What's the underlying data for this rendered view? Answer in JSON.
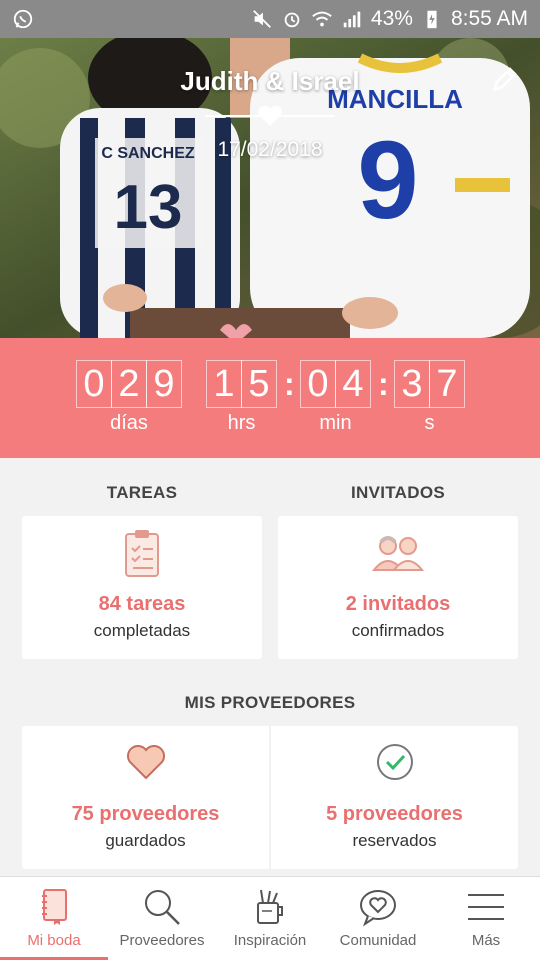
{
  "status_bar": {
    "battery": "43%",
    "time": "8:55 AM"
  },
  "hero": {
    "names": "Judith & Israel",
    "date": "17/02/2018",
    "shirt_left": "C SANCHEZ",
    "number_left": "13",
    "shirt_right": "MANCILLA",
    "number_right": "9"
  },
  "countdown": {
    "days_digits": [
      "0",
      "2",
      "9"
    ],
    "hours_digits": [
      "1",
      "5"
    ],
    "minutes_digits": [
      "0",
      "4"
    ],
    "seconds_digits": [
      "3",
      "7"
    ],
    "colon": ":",
    "labels": {
      "days": "días",
      "hours": "hrs",
      "minutes": "min",
      "seconds": "s"
    }
  },
  "tasks": {
    "title": "TAREAS",
    "count": "84 tareas",
    "caption": "completadas"
  },
  "guests": {
    "title": "INVITADOS",
    "count": "2 invitados",
    "caption": "confirmados"
  },
  "vendors": {
    "title": "MIS PROVEEDORES",
    "saved_count": "75 proveedores",
    "saved_caption": "guardados",
    "booked_count": "5 proveedores",
    "booked_caption": "reservados"
  },
  "bottom_nav": {
    "items": [
      {
        "label": "Mi boda",
        "icon": "notebook-icon",
        "active": true
      },
      {
        "label": "Proveedores",
        "icon": "search-icon",
        "active": false
      },
      {
        "label": "Inspiración",
        "icon": "craft-cup-icon",
        "active": false
      },
      {
        "label": "Comunidad",
        "icon": "chat-heart-icon",
        "active": false
      },
      {
        "label": "Más",
        "icon": "menu-icon",
        "active": false
      }
    ]
  },
  "colors": {
    "accent": "#f47c7c",
    "accent_text": "#e9706f",
    "background": "#f2f2f2"
  }
}
